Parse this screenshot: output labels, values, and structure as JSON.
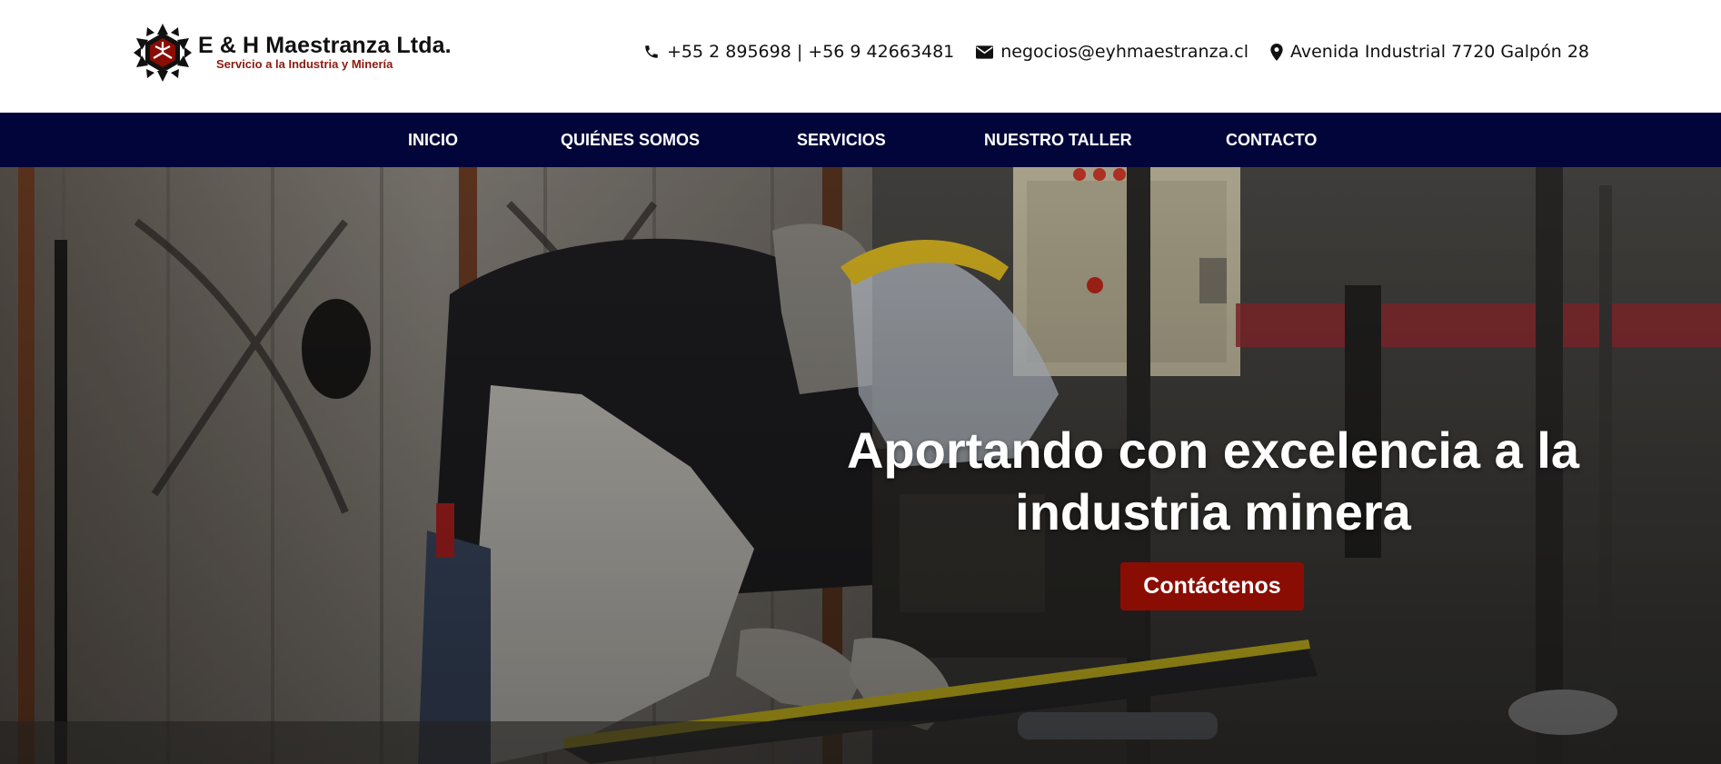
{
  "brand": {
    "name": "E & H Maestranza Ltda.",
    "tagline": "Servicio a la Industria y Minería",
    "logo_icon": "hexagon-star-logo",
    "colors": {
      "navy": "#02053a",
      "red": "#8a0d04",
      "tagline_red": "#8b1a10"
    }
  },
  "contact": {
    "phone_icon": "phone-icon",
    "phone": "+55 2 895698 | +56 9 42663481",
    "email_icon": "envelope-icon",
    "email": "negocios@eyhmaestranza.cl",
    "address_icon": "map-pin-icon",
    "address": "Avenida Industrial 7720 Galpón 28"
  },
  "nav": {
    "items": [
      {
        "label": "INICIO"
      },
      {
        "label": "QUIÉNES SOMOS"
      },
      {
        "label": "SERVICIOS"
      },
      {
        "label": "NUESTRO TALLER"
      },
      {
        "label": "CONTACTO"
      }
    ]
  },
  "hero": {
    "title": "Aportando con excelencia a la industria minera",
    "cta_label": "Contáctenos"
  }
}
